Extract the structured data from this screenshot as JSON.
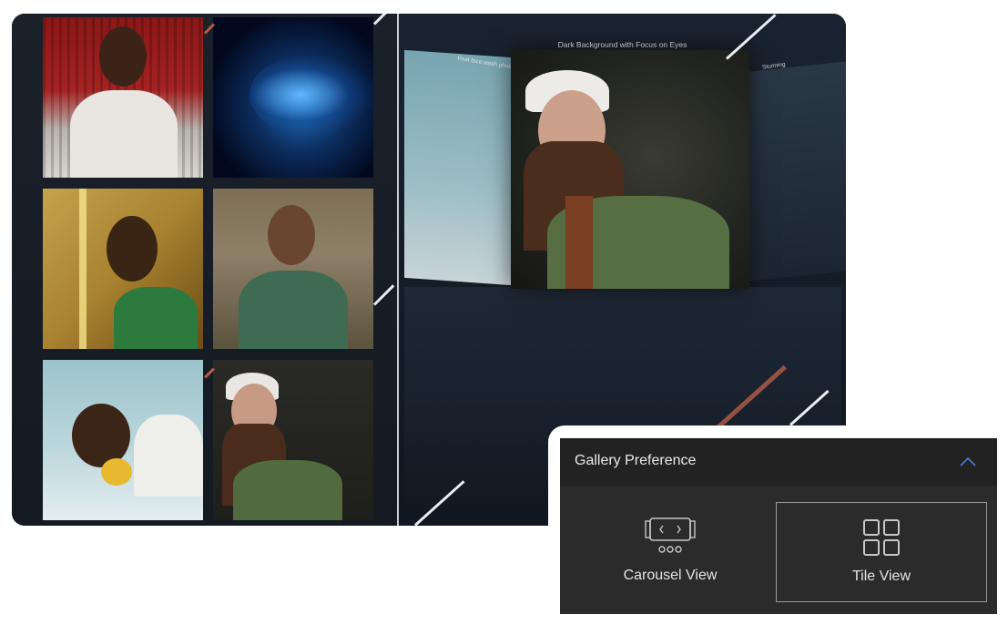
{
  "carousel": {
    "center_title": "Dark Background with Focus on Eyes",
    "left_title": "Fruit face wash photograph",
    "right_title": "Stunning"
  },
  "preference": {
    "title": "Gallery Preference",
    "options": [
      {
        "label": "Carousel View",
        "icon": "carousel-icon",
        "selected": false
      },
      {
        "label": "Tile View",
        "icon": "tile-grid-icon",
        "selected": true
      }
    ]
  },
  "colors": {
    "panel_bg": "#2b2b2b",
    "header_bg": "#222222",
    "accent": "#4a7fd6"
  }
}
